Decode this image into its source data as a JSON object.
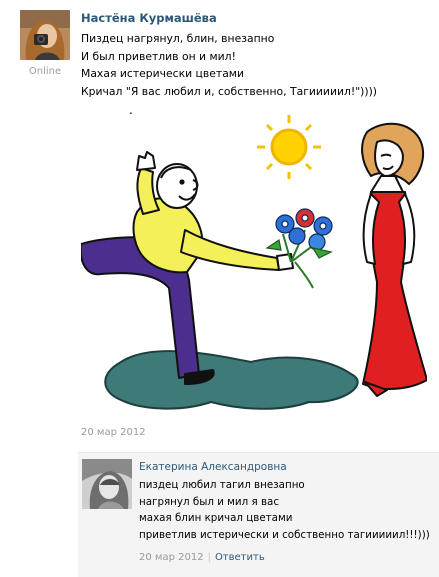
{
  "post": {
    "author": "Настёна Курмашёва",
    "status": "Online",
    "lines": [
      "Пиздец нагрянул, блин, внезапно",
      "И был приветлив он и мил!",
      "Махая истерически цветами",
      "Кричал \"Я вас любил и, собственно, Тагииииил!\"))))"
    ],
    "dot": ".",
    "date": "20 мар 2012"
  },
  "reply": {
    "author": "Екатерина Александровна",
    "lines": [
      "пиздец любил тагил внезапно",
      "нагрянул был и мил я вас",
      "махая блин кричал цветами",
      "приветлив истерически и собственно тагииииил!!!)))"
    ],
    "date": "20 мар 2012",
    "separator": "|",
    "reply_link": "Ответить"
  },
  "colors": {
    "link": "#2b587a",
    "muted": "#999999",
    "reply_bg": "#f4f4f4"
  }
}
